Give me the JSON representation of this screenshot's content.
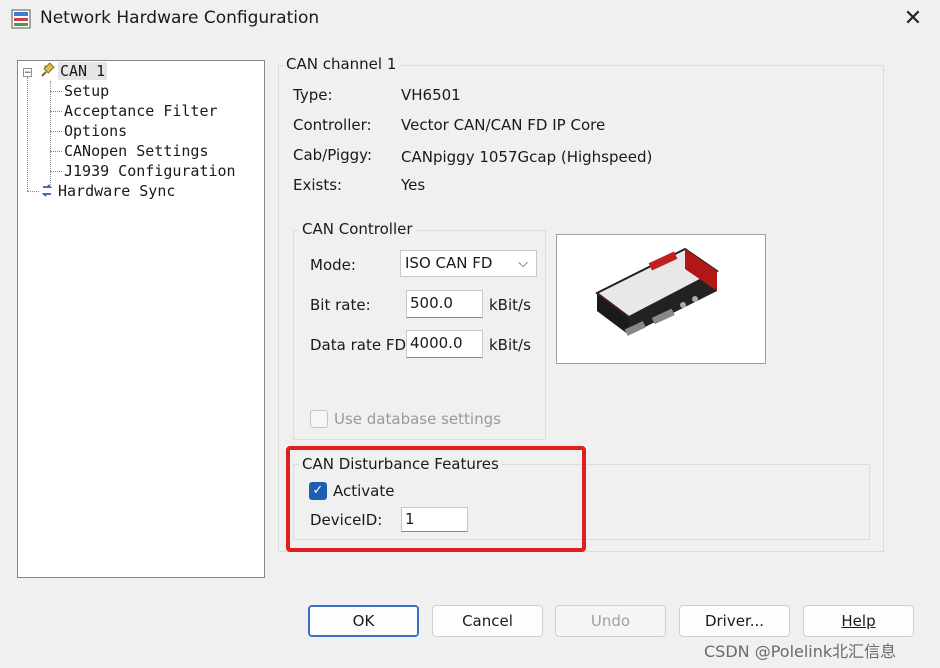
{
  "window": {
    "title": "Network Hardware Configuration",
    "app_icon": "network-config-icon",
    "close_icon": "close-icon",
    "close_glyph": "✕"
  },
  "tree": {
    "root": {
      "label": "CAN 1",
      "expander": "−",
      "icon": "can-plug-icon"
    },
    "children": [
      "Setup",
      "Acceptance Filter",
      "Options",
      "CANopen Settings",
      "J1939 Configuration"
    ],
    "sibling": {
      "label": "Hardware Sync",
      "icon": "sync-icon"
    }
  },
  "channel": {
    "legend": "CAN channel 1",
    "rows": [
      {
        "label": "Type:",
        "value": "VH6501"
      },
      {
        "label": "Controller:",
        "value": "Vector CAN/CAN FD IP Core"
      },
      {
        "label": "Cab/Piggy:",
        "value": "CANpiggy 1057Gcap (Highspeed)"
      },
      {
        "label": "Exists:",
        "value": "Yes"
      }
    ]
  },
  "controller": {
    "legend": "CAN Controller",
    "mode_label": "Mode:",
    "mode_value": "ISO CAN FD",
    "bitrate_label": "Bit rate:",
    "bitrate_value": "500.0",
    "bitrate_unit": "kBit/s",
    "datarate_label": "Data rate FD:",
    "datarate_value": "4000.0",
    "datarate_unit": "kBit/s",
    "use_db_label": "Use database settings",
    "use_db_checked": false
  },
  "disturbance": {
    "legend": "CAN Disturbance Features",
    "activate_label": "Activate",
    "activate_checked": true,
    "deviceid_label": "DeviceID:",
    "deviceid_value": "1"
  },
  "buttons": {
    "ok": "OK",
    "cancel": "Cancel",
    "undo": "Undo",
    "driver": "Driver...",
    "help": "Help"
  },
  "watermark": "CSDN @Polelink北汇信息",
  "colors": {
    "highlight_box": "#e02020",
    "check_accent": "#1e5fb4"
  }
}
